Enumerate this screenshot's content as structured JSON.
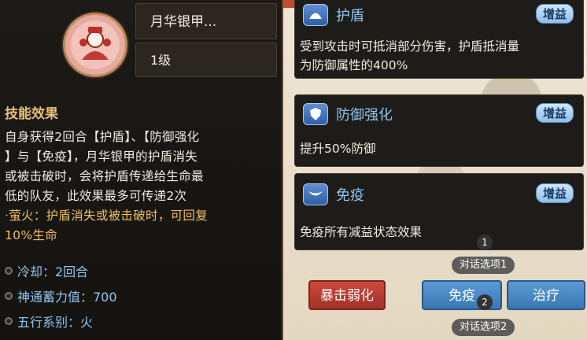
{
  "skill": {
    "name": "月华银甲...",
    "level": "1级",
    "section_title": "技能效果",
    "description_lines": [
      "自身获得2回合【护盾】、【防御强化",
      "】与【免疫】，月华银甲的护盾消失",
      "或被击破时，会将护盾传递给生命最",
      "低的队友，此效果最多可传递2次"
    ],
    "firefly_line1": "·萤火：护盾消失或被击破时，可回复",
    "firefly_line2": "10%生命",
    "stats": [
      {
        "label": "冷却：2回合"
      },
      {
        "label": "神通蓄力值：700"
      },
      {
        "label": "五行系别：火"
      }
    ]
  },
  "buffs": [
    {
      "name": "护盾",
      "tag": "增益",
      "icon": "shield-dome-icon",
      "text_lines": [
        "受到攻击时可抵消部分伤害，护盾抵消量",
        "为防御属性的400%"
      ]
    },
    {
      "name": "防御强化",
      "tag": "增益",
      "icon": "shield-icon",
      "text_lines": [
        "提升50%防御"
      ]
    },
    {
      "name": "免疫",
      "tag": "增益",
      "icon": "immune-icon",
      "text_lines": [
        "免疫所有减益状态效果"
      ]
    }
  ],
  "buttons": {
    "crit_weaken": "暴击弱化",
    "immune": "免疫",
    "heal": "治疗"
  },
  "hints": [
    {
      "number": "1",
      "label": "对话选项1"
    },
    {
      "number": "2",
      "label": "对话选项2"
    }
  ],
  "colors": {
    "panel_bg": "#1c1a17",
    "gold": "#e8c07a",
    "blue_text": "#8fc5ef",
    "red_button": "#c9483a",
    "blue_button": "#5b9bd4"
  }
}
